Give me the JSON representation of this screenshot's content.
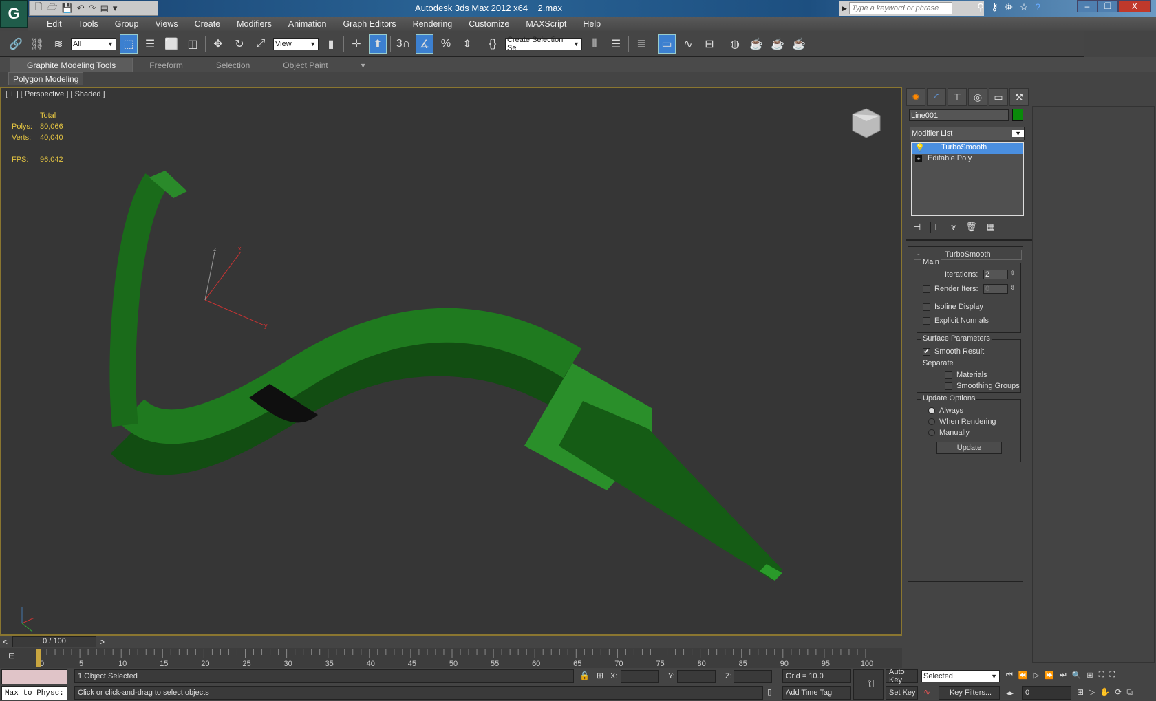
{
  "app": {
    "title": "Autodesk 3ds Max  2012 x64",
    "file": "2.max",
    "logo": "G"
  },
  "search": {
    "placeholder": "Type a keyword or phrase"
  },
  "menu": [
    "Edit",
    "Tools",
    "Group",
    "Views",
    "Create",
    "Modifiers",
    "Animation",
    "Graph Editors",
    "Rendering",
    "Customize",
    "MAXScript",
    "Help"
  ],
  "toolbar": {
    "filter": "All",
    "ref_coord": "View",
    "selection_set": "Create Selection Se",
    "snap_label": "3"
  },
  "ribbon": {
    "tabs": [
      "Graphite Modeling Tools",
      "Freeform",
      "Selection",
      "Object Paint"
    ],
    "active": "Graphite Modeling Tools",
    "panel": "Polygon Modeling"
  },
  "viewport": {
    "label": "[ + ] [ Perspective ] [ Shaded ]",
    "stats": {
      "header": "Total",
      "polys_label": "Polys:",
      "polys": "80,066",
      "verts_label": "Verts:",
      "verts": "40,040",
      "fps_label": "FPS:",
      "fps": "96.042"
    },
    "axes": [
      "x",
      "y",
      "z"
    ],
    "object_color": "#1f7a1f"
  },
  "command_panel": {
    "object_name": "Line001",
    "object_color": "#0a8a0a",
    "modifier_list": "Modifier List",
    "stack": [
      {
        "label": "TurboSmooth",
        "selected": true
      },
      {
        "label": "Editable Poly",
        "selected": false
      }
    ],
    "rollout": "TurboSmooth",
    "rollout_toggle": "-",
    "main": {
      "title": "Main",
      "iterations_label": "Iterations:",
      "iterations": "2",
      "render_iters_label": "Render Iters:",
      "render_iters": "0",
      "render_iters_checked": false,
      "isoline": "Isoline Display",
      "isoline_checked": false,
      "explicit_normals": "Explicit Normals",
      "explicit_checked": false
    },
    "surface": {
      "title": "Surface Parameters",
      "smooth_result": "Smooth Result",
      "smooth_checked": true,
      "separate": "Separate",
      "materials": "Materials",
      "smoothing_groups": "Smoothing Groups"
    },
    "update": {
      "title": "Update Options",
      "options": [
        "Always",
        "When Rendering",
        "Manually"
      ],
      "selected": "Always",
      "button": "Update"
    }
  },
  "timeline": {
    "frame": "0 / 100",
    "prev": "<",
    "next": ">",
    "start": 0,
    "end": 100,
    "step": 5,
    "current": 0
  },
  "status": {
    "script_listener": "Max to Physc:",
    "selected": "1 Object Selected",
    "prompt": "Click or click-and-drag to select objects",
    "x_label": "X:",
    "y_label": "Y:",
    "z_label": "Z:",
    "x": "",
    "y": "",
    "z": "",
    "grid": "Grid = 10.0",
    "add_time_tag": "Add Time Tag",
    "auto_key": "Auto Key",
    "set_key": "Set Key",
    "key_mode": "Selected",
    "key_filters": "Key Filters...",
    "frame_field": "0"
  }
}
